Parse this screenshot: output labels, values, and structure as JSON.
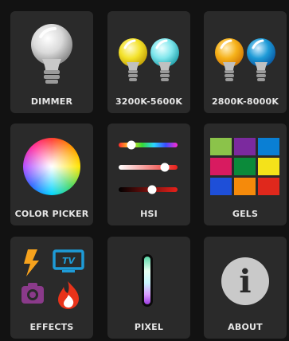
{
  "tiles": [
    {
      "id": "dimmer",
      "label": "DIMMER",
      "icon": "white-bulb-icon"
    },
    {
      "id": "cct-3200-5600",
      "label": "3200K-5600K",
      "icon": "yellow-cyan-bulbs-icon"
    },
    {
      "id": "cct-2800-8000",
      "label": "2800K-8000K",
      "icon": "orange-blue-bulbs-icon"
    },
    {
      "id": "color-picker",
      "label": "COLOR PICKER",
      "icon": "color-wheel-icon"
    },
    {
      "id": "hsi",
      "label": "HSI",
      "icon": "hsi-sliders-icon"
    },
    {
      "id": "gels",
      "label": "GELS",
      "icon": "gels-grid-icon"
    },
    {
      "id": "effects",
      "label": "EFFECTS",
      "icon": "effects-icons-group",
      "sub_icons": {
        "tv_text": "TV"
      }
    },
    {
      "id": "pixel",
      "label": "PIXEL",
      "icon": "pixel-tube-icon"
    },
    {
      "id": "about",
      "label": "ABOUT",
      "icon": "info-icon",
      "glyph": "i"
    }
  ],
  "gel_colors": [
    "#8bc34a",
    "#7b2a9e",
    "#0a7fd4",
    "#d81b60",
    "#0b8a3a",
    "#f4e21a",
    "#1e4fd8",
    "#f58a0b",
    "#e0281c"
  ],
  "colors": {
    "background": "#121212",
    "tile": "#2a2a2a",
    "label": "#e6e6e6",
    "accent_blue": "#1e9bd7",
    "bolt": "#f6a21d",
    "camera": "#8a3a8a",
    "fire": "#e8331a"
  }
}
